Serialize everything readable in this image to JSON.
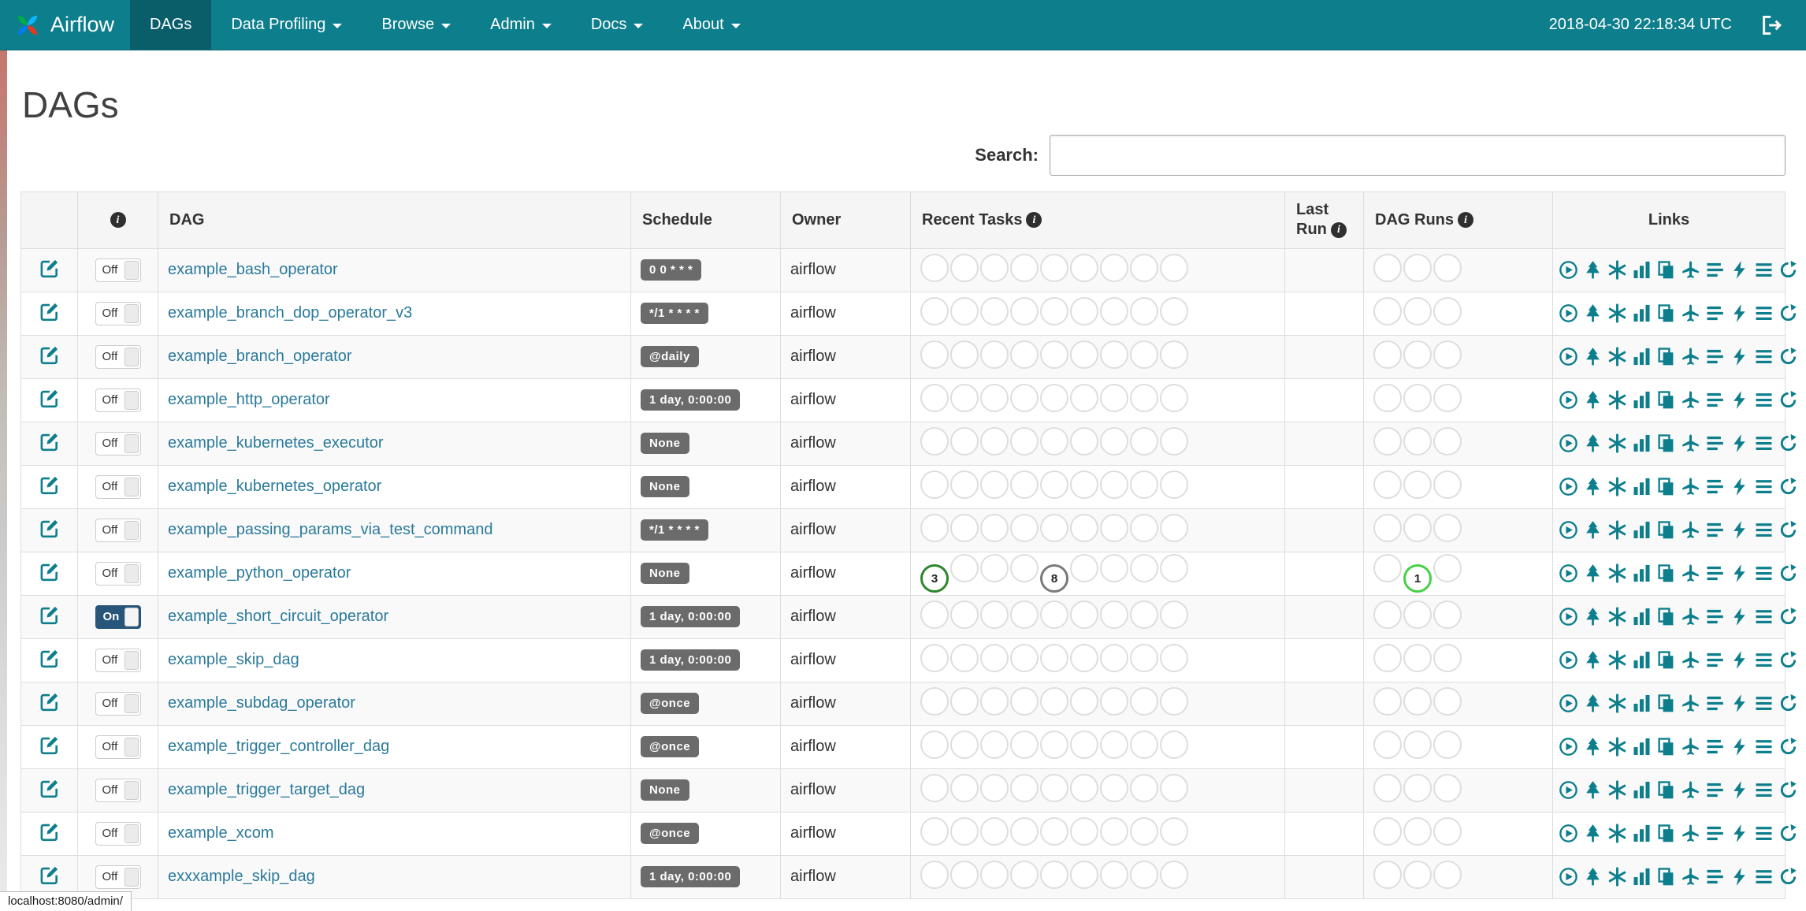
{
  "colors": {
    "navbar": "#0d7e8c",
    "navbar-active": "#095e69",
    "teal": "#0d7e8c",
    "link": "#2a7a9b",
    "badge": "#6b6b6b",
    "toggle-on": "#28567a"
  },
  "navbar": {
    "brand": "Airflow",
    "menu": [
      {
        "label": "DAGs",
        "active": true,
        "caret": false
      },
      {
        "label": "Data Profiling",
        "active": false,
        "caret": true
      },
      {
        "label": "Browse",
        "active": false,
        "caret": true
      },
      {
        "label": "Admin",
        "active": false,
        "caret": true
      },
      {
        "label": "Docs",
        "active": false,
        "caret": true
      },
      {
        "label": "About",
        "active": false,
        "caret": true
      }
    ],
    "clock": "2018-04-30 22:18:34 UTC"
  },
  "page": {
    "title": "DAGs"
  },
  "search": {
    "label": "Search:",
    "value": ""
  },
  "table": {
    "headers": {
      "dag": "DAG",
      "schedule": "Schedule",
      "owner": "Owner",
      "recent_tasks": "Recent Tasks",
      "last_run": "Last Run",
      "dag_runs": "DAG Runs",
      "links": "Links"
    },
    "recent_task_slots": 9,
    "dag_run_slots": 3,
    "links_icons": [
      "trigger-dag",
      "tree-view",
      "graph-view",
      "tasks-duration",
      "task-tries",
      "landing-times",
      "gantt",
      "code",
      "logs",
      "refresh"
    ],
    "rows": [
      {
        "dag_id": "example_bash_operator",
        "toggle": "Off",
        "schedule": "0 0 * * *",
        "owner": "airflow",
        "last_run": "",
        "recent_tasks": {},
        "dag_runs": {}
      },
      {
        "dag_id": "example_branch_dop_operator_v3",
        "toggle": "Off",
        "schedule": "*/1 * * * *",
        "owner": "airflow",
        "last_run": "",
        "recent_tasks": {},
        "dag_runs": {}
      },
      {
        "dag_id": "example_branch_operator",
        "toggle": "Off",
        "schedule": "@daily",
        "owner": "airflow",
        "last_run": "",
        "recent_tasks": {},
        "dag_runs": {}
      },
      {
        "dag_id": "example_http_operator",
        "toggle": "Off",
        "schedule": "1 day, 0:00:00",
        "owner": "airflow",
        "last_run": "",
        "recent_tasks": {},
        "dag_runs": {}
      },
      {
        "dag_id": "example_kubernetes_executor",
        "toggle": "Off",
        "schedule": "None",
        "owner": "airflow",
        "last_run": "",
        "recent_tasks": {},
        "dag_runs": {}
      },
      {
        "dag_id": "example_kubernetes_operator",
        "toggle": "Off",
        "schedule": "None",
        "owner": "airflow",
        "last_run": "",
        "recent_tasks": {},
        "dag_runs": {}
      },
      {
        "dag_id": "example_passing_params_via_test_command",
        "toggle": "Off",
        "schedule": "*/1 * * * *",
        "owner": "airflow",
        "last_run": "",
        "recent_tasks": {},
        "dag_runs": {}
      },
      {
        "dag_id": "example_python_operator",
        "toggle": "Off",
        "schedule": "None",
        "owner": "airflow",
        "last_run": "",
        "recent_tasks": {
          "0": {
            "count": 3,
            "color": "#2d862d"
          },
          "4": {
            "count": 8,
            "color": "#7a7a7a"
          }
        },
        "dag_runs": {
          "1": {
            "count": 1,
            "color": "#45d145"
          }
        }
      },
      {
        "dag_id": "example_short_circuit_operator",
        "toggle": "On",
        "schedule": "1 day, 0:00:00",
        "owner": "airflow",
        "last_run": "",
        "recent_tasks": {},
        "dag_runs": {}
      },
      {
        "dag_id": "example_skip_dag",
        "toggle": "Off",
        "schedule": "1 day, 0:00:00",
        "owner": "airflow",
        "last_run": "",
        "recent_tasks": {},
        "dag_runs": {}
      },
      {
        "dag_id": "example_subdag_operator",
        "toggle": "Off",
        "schedule": "@once",
        "owner": "airflow",
        "last_run": "",
        "recent_tasks": {},
        "dag_runs": {}
      },
      {
        "dag_id": "example_trigger_controller_dag",
        "toggle": "Off",
        "schedule": "@once",
        "owner": "airflow",
        "last_run": "",
        "recent_tasks": {},
        "dag_runs": {}
      },
      {
        "dag_id": "example_trigger_target_dag",
        "toggle": "Off",
        "schedule": "None",
        "owner": "airflow",
        "last_run": "",
        "recent_tasks": {},
        "dag_runs": {}
      },
      {
        "dag_id": "example_xcom",
        "toggle": "Off",
        "schedule": "@once",
        "owner": "airflow",
        "last_run": "",
        "recent_tasks": {},
        "dag_runs": {}
      },
      {
        "dag_id": "exxxample_skip_dag",
        "toggle": "Off",
        "schedule": "1 day, 0:00:00",
        "owner": "airflow",
        "last_run": "",
        "recent_tasks": {},
        "dag_runs": {}
      }
    ]
  },
  "status_bar": {
    "text": "localhost:8080/admin/"
  }
}
